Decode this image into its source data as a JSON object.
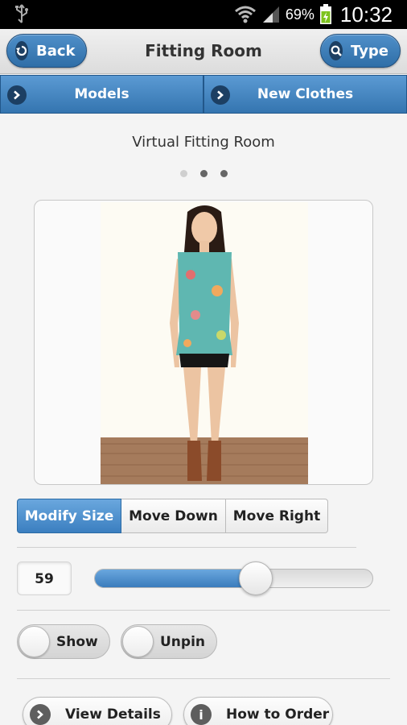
{
  "status_bar": {
    "battery_percent": "69%",
    "time": "10:32",
    "icons": [
      "usb-icon",
      "wifi-icon",
      "signal-icon",
      "battery-icon"
    ]
  },
  "header": {
    "title": "Fitting Room",
    "back_label": "Back",
    "type_label": "Type"
  },
  "navbar": {
    "items": [
      {
        "label": "Models"
      },
      {
        "label": "New Clothes"
      }
    ]
  },
  "content": {
    "title": "Virtual Fitting Room",
    "pagination": {
      "count": 3,
      "active": 0
    }
  },
  "controls": {
    "segments": [
      {
        "label": "Modify Size",
        "active": true
      },
      {
        "label": "Move Down",
        "active": false
      },
      {
        "label": "Move Right",
        "active": false
      }
    ],
    "slider_value": "59",
    "slider_fraction": 0.58,
    "toggles": [
      {
        "label": "Show"
      },
      {
        "label": "Unpin"
      }
    ]
  },
  "footer": {
    "view_details_label": "View Details",
    "how_to_order_label": "How to Order"
  },
  "colors": {
    "accent_blue": "#3b7fc0",
    "nav_blue": "#3475b0",
    "dark_icon": "#1c3f63"
  }
}
